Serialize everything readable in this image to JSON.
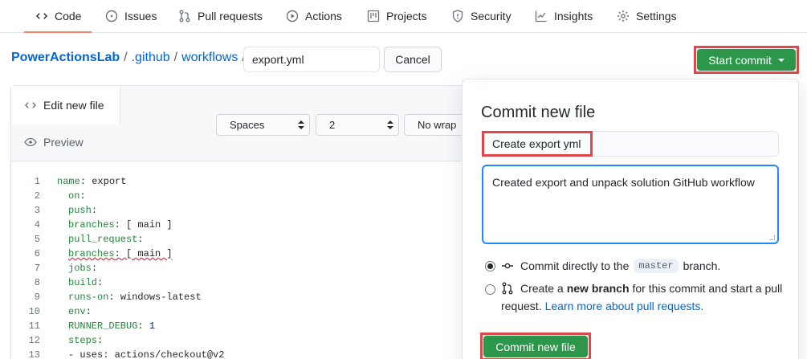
{
  "nav": {
    "tabs": [
      {
        "label": "Code",
        "icon": "code-icon",
        "active": true
      },
      {
        "label": "Issues",
        "icon": "issues-icon"
      },
      {
        "label": "Pull requests",
        "icon": "pull-request-icon"
      },
      {
        "label": "Actions",
        "icon": "play-icon"
      },
      {
        "label": "Projects",
        "icon": "project-icon"
      },
      {
        "label": "Security",
        "icon": "shield-icon"
      },
      {
        "label": "Insights",
        "icon": "graph-icon"
      },
      {
        "label": "Settings",
        "icon": "gear-icon"
      }
    ]
  },
  "breadcrumb": {
    "repo": "PowerActionsLab",
    "sep": "/",
    "folder1": ".github",
    "folder2": "workflows"
  },
  "filename": {
    "value": "export.yml"
  },
  "cancel_label": "Cancel",
  "start_commit_label": "Start commit",
  "editor": {
    "edit_tab": "Edit new file",
    "preview_tab": "Preview",
    "indent_mode": "Spaces",
    "indent_size": "2",
    "wrap_mode": "No wrap",
    "lines": [
      {
        "n": "1",
        "key": "name",
        "rest": " export",
        "indent": ""
      },
      {
        "n": "2",
        "key": "on",
        "rest": "",
        "indent": "  "
      },
      {
        "n": "3",
        "key": "push",
        "rest": "",
        "indent": "  "
      },
      {
        "n": "4",
        "key": "branches",
        "rest": " [ main ]",
        "indent": "  "
      },
      {
        "n": "5",
        "key": "pull_request",
        "rest": "",
        "indent": "  "
      },
      {
        "n": "6",
        "key": "branches",
        "rest": " [ main ]",
        "indent": "  "
      },
      {
        "n": "7",
        "key": "jobs",
        "rest": "",
        "indent": "  "
      },
      {
        "n": "8",
        "key": "build",
        "rest": "",
        "indent": "  "
      },
      {
        "n": "9",
        "key": "runs-on",
        "rest": " windows-latest",
        "indent": "  "
      },
      {
        "n": "10",
        "key": "env",
        "rest": "",
        "indent": "  "
      },
      {
        "n": "11",
        "key": "RUNNER_DEBUG",
        "rest": " 1",
        "indent": "  "
      },
      {
        "n": "12",
        "key": "steps",
        "rest": "",
        "indent": "  "
      },
      {
        "n": "13",
        "key": "- uses",
        "rest": " actions/checkout@v2",
        "indent": "  "
      }
    ]
  },
  "commit": {
    "title": "Commit new file",
    "summary": "Create export yml",
    "description": "Created export and unpack solution GitHub workflow",
    "option_direct_pre": "Commit directly to the",
    "option_direct_branch": "master",
    "option_direct_post": "branch.",
    "option_new_pre": "Create a",
    "option_new_bold": "new branch",
    "option_new_post": "for this commit and start a pull",
    "option_new_line2": "request.",
    "option_new_link": "Learn more about pull requests.",
    "button": "Commit new file"
  }
}
